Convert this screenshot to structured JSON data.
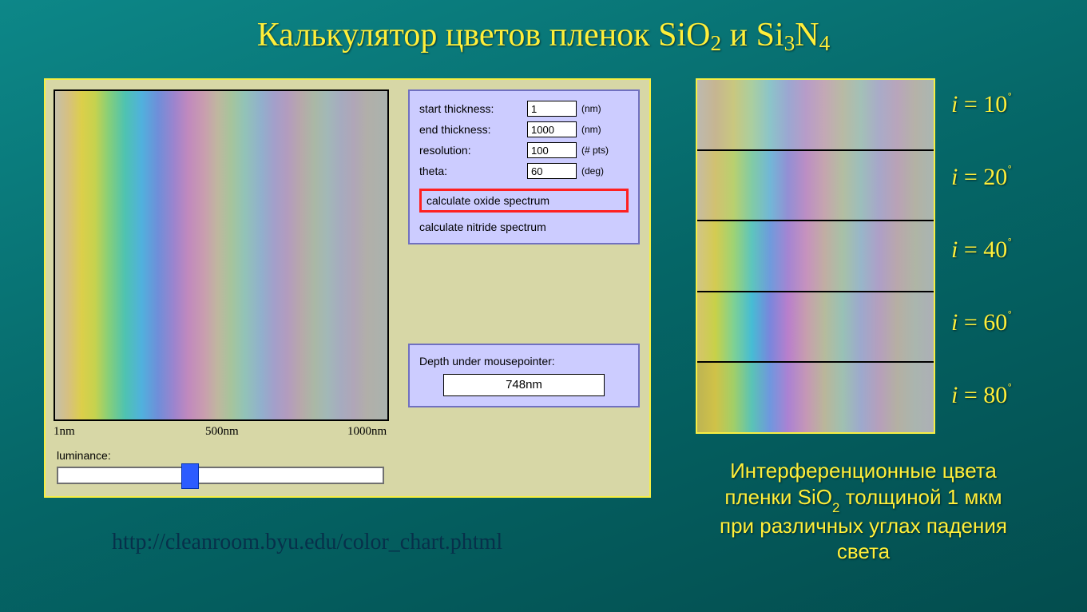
{
  "title": {
    "prefix": "Калькулятор цветов пленок SiO",
    "sub1": "2",
    "mid": "  и Si",
    "sub2": "3",
    "mid2": "N",
    "sub3": "4"
  },
  "axis": {
    "t0": "1nm",
    "t1": "500nm",
    "t2": "1000nm"
  },
  "form": {
    "labels": {
      "start": "start thickness:",
      "end": "end thickness:",
      "res": "resolution:",
      "theta": "theta:"
    },
    "values": {
      "start": "1",
      "end": "1000",
      "res": "100",
      "theta": "60"
    },
    "units": {
      "start": "(nm)",
      "end": "(nm)",
      "res": "(# pts)",
      "theta": "(deg)"
    },
    "btn_oxide": "calculate oxide spectrum",
    "btn_nitride": "calculate nitride spectrum"
  },
  "readout": {
    "label": "Depth under mousepointer:",
    "value": "748nm"
  },
  "luminance_label": "luminance:",
  "source_url": "http://cleanroom.byu.edu/color_chart.phtml",
  "angles": [
    "10",
    "20",
    "40",
    "60",
    "80"
  ],
  "angle_prefix": "i",
  "angle_eq": " = ",
  "caption": {
    "l1a": "Интерференционные цвета",
    "l2a": "пленки SiO",
    "l2sub": "2",
    "l2b": " толщиной 1 мкм",
    "l3": "при различных углах падения",
    "l4": "света"
  }
}
